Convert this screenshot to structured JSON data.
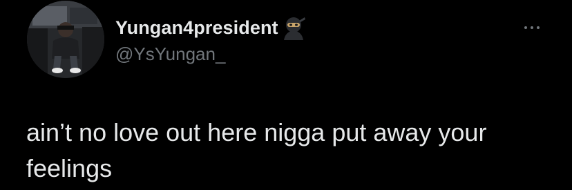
{
  "tweet": {
    "author": {
      "display_name": "Yungan4president",
      "handle": "@YsYungan_",
      "name_emoji": "ninja-icon",
      "avatar": "profile-photo"
    },
    "text": "ain’t no love out here nigga put away your feelings",
    "menu_icon": "more-options-icon"
  },
  "colors": {
    "background": "#000000",
    "primary_text": "#e7e9ea",
    "secondary_text": "#71767b"
  }
}
